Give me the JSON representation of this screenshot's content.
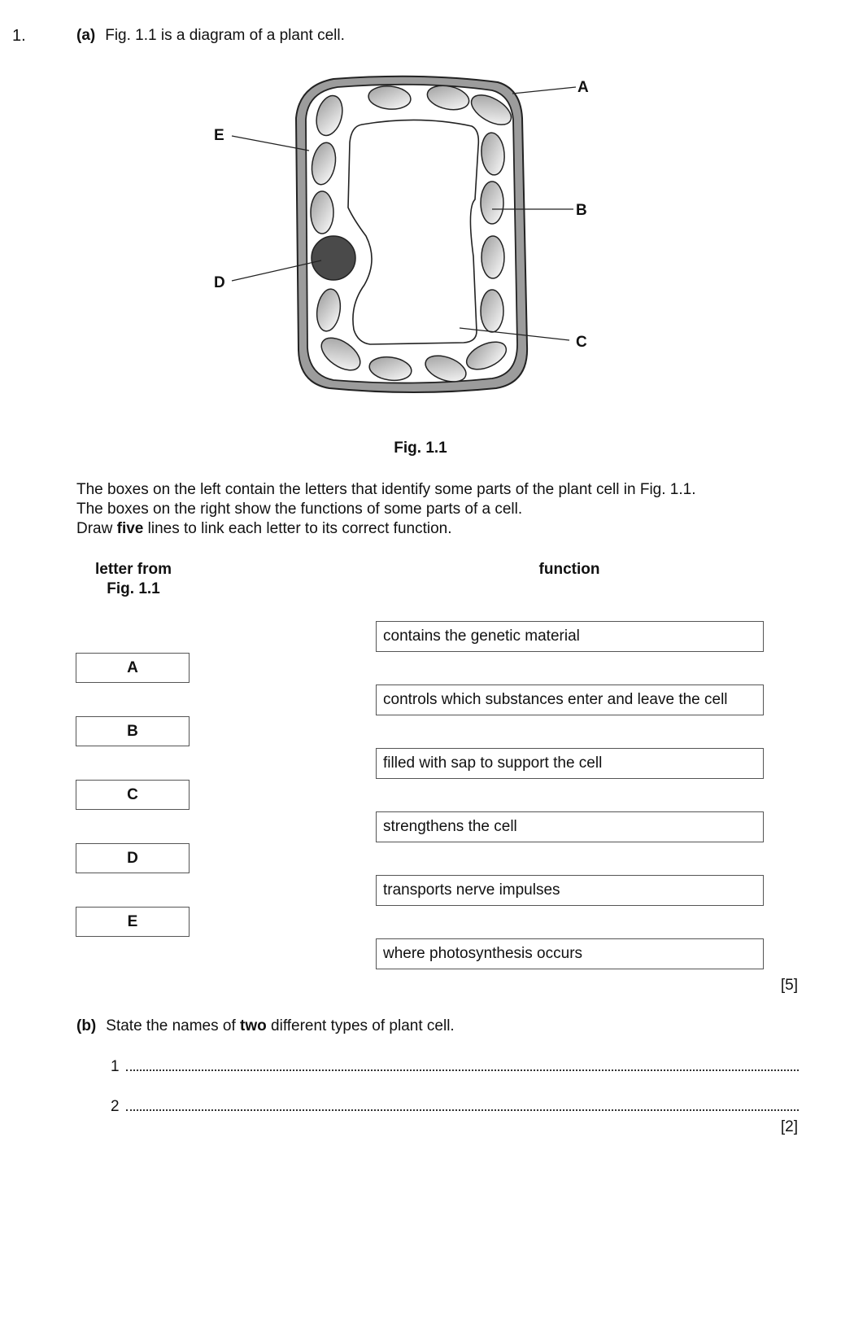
{
  "question": {
    "number": "1.",
    "part_a": {
      "label": "(a)",
      "text": "Fig. 1.1 is a diagram of a plant cell.",
      "figure": {
        "caption": "Fig. 1.1",
        "labels": [
          "A",
          "B",
          "C",
          "D",
          "E"
        ]
      },
      "instructions": {
        "line1": "The boxes on the left contain the letters that identify some parts of the plant cell in Fig. 1.1.",
        "line2": "The boxes on the right show the functions of some parts of a cell.",
        "line3_pre": "Draw ",
        "line3_bold": "five",
        "line3_post": " lines to link each letter to its correct function."
      },
      "left_heading_1": "letter from",
      "left_heading_2": "Fig. 1.1",
      "right_heading": "function",
      "letters": [
        "A",
        "B",
        "C",
        "D",
        "E"
      ],
      "functions": [
        "contains the genetic material",
        "controls which substances enter and leave the cell",
        "filled with sap to support the cell",
        "strengthens the cell",
        "transports nerve impulses",
        "where photosynthesis occurs"
      ],
      "marks": "[5]"
    },
    "part_b": {
      "label": "(b)",
      "text_pre": "State the names of ",
      "text_bold": "two",
      "text_post": " different types of plant cell.",
      "answer_numbers": [
        "1",
        "2"
      ],
      "marks": "[2]"
    }
  }
}
